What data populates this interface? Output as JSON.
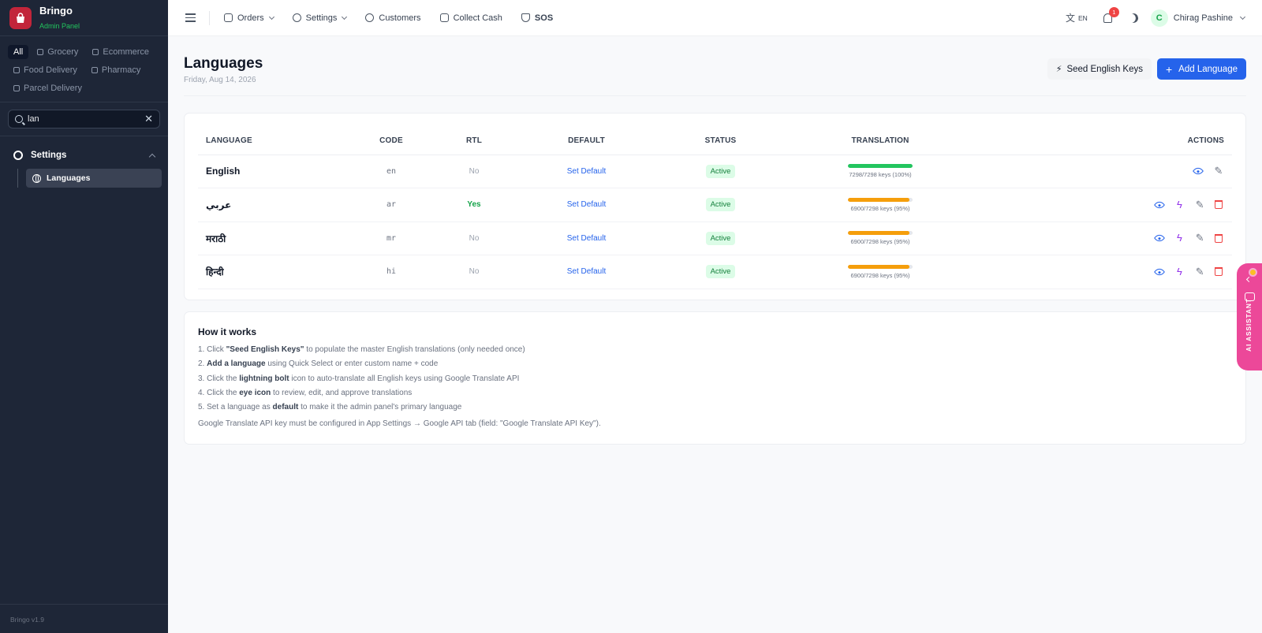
{
  "brand": {
    "name": "Bringo",
    "subtitle": "Admin Panel",
    "version": "Bringo v1.9"
  },
  "categories": [
    "All",
    "Grocery",
    "Ecommerce",
    "Food Delivery",
    "Pharmacy",
    "Parcel Delivery"
  ],
  "search": {
    "value": "lan",
    "placeholder": ""
  },
  "nav": {
    "section": "Settings",
    "item": "Languages"
  },
  "topbar": {
    "orders": "Orders",
    "settings": "Settings",
    "customers": "Customers",
    "collect_cash": "Collect Cash",
    "sos": "SOS",
    "lang": "EN",
    "notifications": "1",
    "user_initial": "C",
    "user_name": "Chirag Pashine"
  },
  "page": {
    "title": "Languages",
    "date": "Friday, Aug 14, 2026",
    "seed_button": "Seed English Keys",
    "add_button": "Add Language"
  },
  "table": {
    "headers": [
      "LANGUAGE",
      "CODE",
      "RTL",
      "DEFAULT",
      "STATUS",
      "TRANSLATION",
      "ACTIONS"
    ],
    "rows": [
      {
        "language": "English",
        "code": "en",
        "rtl": "No",
        "default": "Set Default",
        "status": "Active",
        "progress": 100,
        "progress_text": "7298/7298 keys (100%)",
        "color": "#22c55e"
      },
      {
        "language": "عربي",
        "code": "ar",
        "rtl": "Yes",
        "default": "Set Default",
        "status": "Active",
        "progress": 95,
        "progress_text": "6900/7298 keys (95%)",
        "color": "#f59e0b"
      },
      {
        "language": "मराठी",
        "code": "mr",
        "rtl": "No",
        "default": "Set Default",
        "status": "Active",
        "progress": 95,
        "progress_text": "6900/7298 keys (95%)",
        "color": "#f59e0b"
      },
      {
        "language": "हिन्दी",
        "code": "hi",
        "rtl": "No",
        "default": "Set Default",
        "status": "Active",
        "progress": 95,
        "progress_text": "6900/7298 keys (95%)",
        "color": "#f59e0b"
      }
    ]
  },
  "help": {
    "title": "How it works",
    "steps": [
      {
        "n": "1. Click ",
        "b": "\"Seed English Keys\"",
        "t": " to populate the master English translations (only needed once)"
      },
      {
        "n": "2. ",
        "b": "Add a language",
        "t": " using Quick Select or enter custom name + code"
      },
      {
        "n": "3. Click the ",
        "b": "lightning bolt",
        "t": " icon to auto-translate all English keys using Google Translate API"
      },
      {
        "n": "4. Click the ",
        "b": "eye icon",
        "t": " to review, edit, and approve translations"
      },
      {
        "n": "5. Set a language as ",
        "b": "default",
        "t": " to make it the admin panel's primary language"
      }
    ],
    "note": "Google Translate API key must be configured in App Settings → Google API tab (field: \"Google Translate API Key\")."
  },
  "ai_assistant": "AI ASSISTANT",
  "colors": {
    "accent": "#2563eb",
    "sidebar": "#1e2637",
    "brand": "#c2253a",
    "ai_tab": "#ec4899"
  }
}
